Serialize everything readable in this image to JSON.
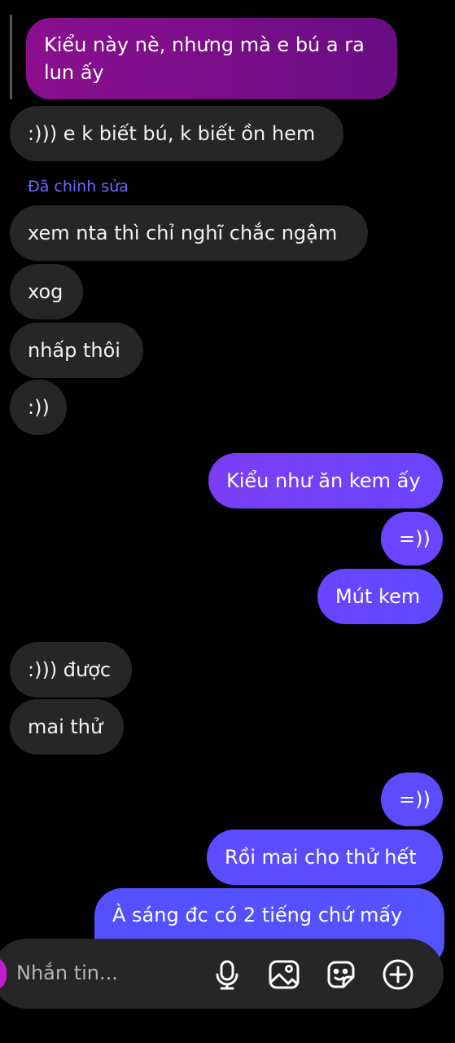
{
  "thread": {
    "reply_quote": "Kiểu này nè, nhưng mà e bú a ra lun ấy",
    "edited_label": "Đã chinh sửa",
    "messages": [
      {
        "side": "in",
        "text": ":))) e k biết bú, k biết ồn hem"
      },
      {
        "side": "in",
        "text": "xem nta thì chỉ nghĩ chắc ngậm"
      },
      {
        "side": "in",
        "text": "xog"
      },
      {
        "side": "in",
        "text": "nhấp thôi"
      },
      {
        "side": "in",
        "text": ":))"
      },
      {
        "side": "out",
        "text": "Kiểu như ăn kem ấy"
      },
      {
        "side": "out",
        "text": "=))"
      },
      {
        "side": "out",
        "text": "Mút kem"
      },
      {
        "side": "in",
        "text": ":))) được"
      },
      {
        "side": "in",
        "text": "mai thử"
      },
      {
        "side": "out",
        "text": "=))"
      },
      {
        "side": "out",
        "text": "Rồi mai cho thử hết"
      },
      {
        "side": "out",
        "text": "À sáng đc có 2 tiếng chứ mấy"
      }
    ]
  },
  "composer": {
    "placeholder": "Nhắn tin...",
    "icons": [
      "microphone-icon",
      "image-icon",
      "sticker-icon",
      "add-icon"
    ]
  },
  "colors": {
    "background": "#000000",
    "incoming_bubble": "#262626",
    "outgoing_gradient": [
      "#7b3ff0",
      "#5b4bff"
    ],
    "reply_quote": "#8a0f8e",
    "edited_label": "#6f6bff"
  }
}
